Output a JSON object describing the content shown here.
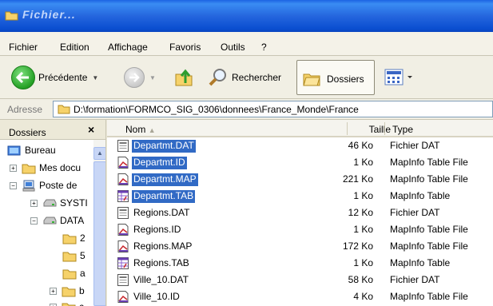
{
  "window": {
    "title": "Fichier..."
  },
  "menu": [
    "Fichier",
    "Edition",
    "Affichage",
    "Favoris",
    "Outils",
    "?"
  ],
  "toolbar": {
    "back_label": "Précédente",
    "search_label": "Rechercher",
    "folders_label": "Dossiers"
  },
  "address": {
    "label": "Adresse",
    "path": "D:\\formation\\FORMCO_SIG_0306\\donnees\\France_Monde\\France"
  },
  "folders_pane": {
    "title": "Dossiers",
    "close": "×",
    "items": [
      {
        "label": "Bureau",
        "expander": ""
      },
      {
        "label": "Mes docu",
        "expander": "+"
      },
      {
        "label": "Poste de",
        "expander": "−"
      },
      {
        "label": "SYSTI",
        "expander": "+"
      },
      {
        "label": "DATA",
        "expander": "−"
      },
      {
        "label": "2",
        "expander": ""
      },
      {
        "label": "5",
        "expander": ""
      },
      {
        "label": "a",
        "expander": ""
      },
      {
        "label": "b",
        "expander": "+"
      },
      {
        "label": "c",
        "expander": "+"
      }
    ]
  },
  "columns": {
    "name": "Nom",
    "size": "Taille",
    "type": "Type"
  },
  "files": [
    {
      "name": "Departmt.DAT",
      "size": "46 Ko",
      "type": "Fichier DAT",
      "icon": "dat-file-icon",
      "selected": true
    },
    {
      "name": "Departmt.ID",
      "size": "1 Ko",
      "type": "MapInfo Table File",
      "icon": "mapinfo-file-icon",
      "selected": true
    },
    {
      "name": "Departmt.MAP",
      "size": "221 Ko",
      "type": "MapInfo Table File",
      "icon": "mapinfo-file-icon",
      "selected": true
    },
    {
      "name": "Departmt.TAB",
      "size": "1 Ko",
      "type": "MapInfo Table",
      "icon": "mapinfo-table-icon",
      "selected": true
    },
    {
      "name": "Regions.DAT",
      "size": "12 Ko",
      "type": "Fichier DAT",
      "icon": "dat-file-icon",
      "selected": false
    },
    {
      "name": "Regions.ID",
      "size": "1 Ko",
      "type": "MapInfo Table File",
      "icon": "mapinfo-file-icon",
      "selected": false
    },
    {
      "name": "Regions.MAP",
      "size": "172 Ko",
      "type": "MapInfo Table File",
      "icon": "mapinfo-file-icon",
      "selected": false
    },
    {
      "name": "Regions.TAB",
      "size": "1 Ko",
      "type": "MapInfo Table",
      "icon": "mapinfo-table-icon",
      "selected": false
    },
    {
      "name": "Ville_10.DAT",
      "size": "58 Ko",
      "type": "Fichier DAT",
      "icon": "dat-file-icon",
      "selected": false
    },
    {
      "name": "Ville_10.ID",
      "size": "4 Ko",
      "type": "MapInfo Table File",
      "icon": "mapinfo-file-icon",
      "selected": false
    }
  ]
}
